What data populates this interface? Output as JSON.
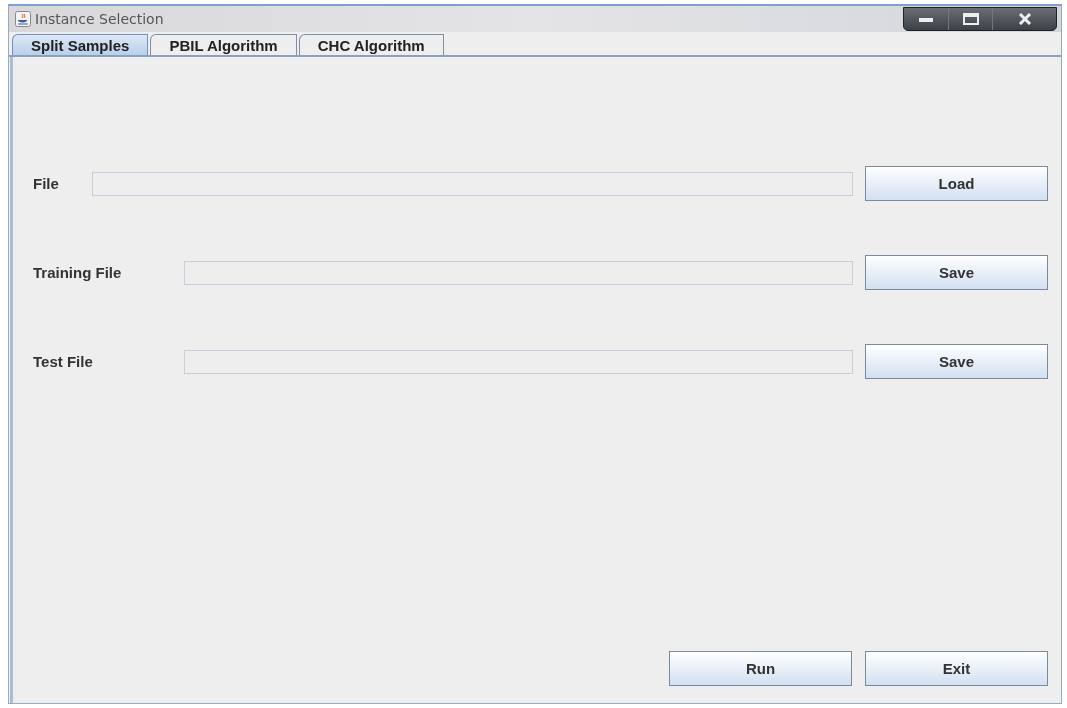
{
  "window": {
    "title": "Instance Selection"
  },
  "tabs": [
    {
      "label": "Split Samples",
      "selected": true
    },
    {
      "label": "PBIL Algorithm",
      "selected": false
    },
    {
      "label": "CHC Algorithm",
      "selected": false
    }
  ],
  "rows": [
    {
      "label": "File",
      "button": "Load"
    },
    {
      "label": "Training File",
      "button": "Save"
    },
    {
      "label": "Test File",
      "button": "Save"
    }
  ],
  "buttons": [
    "Run",
    "Exit"
  ]
}
